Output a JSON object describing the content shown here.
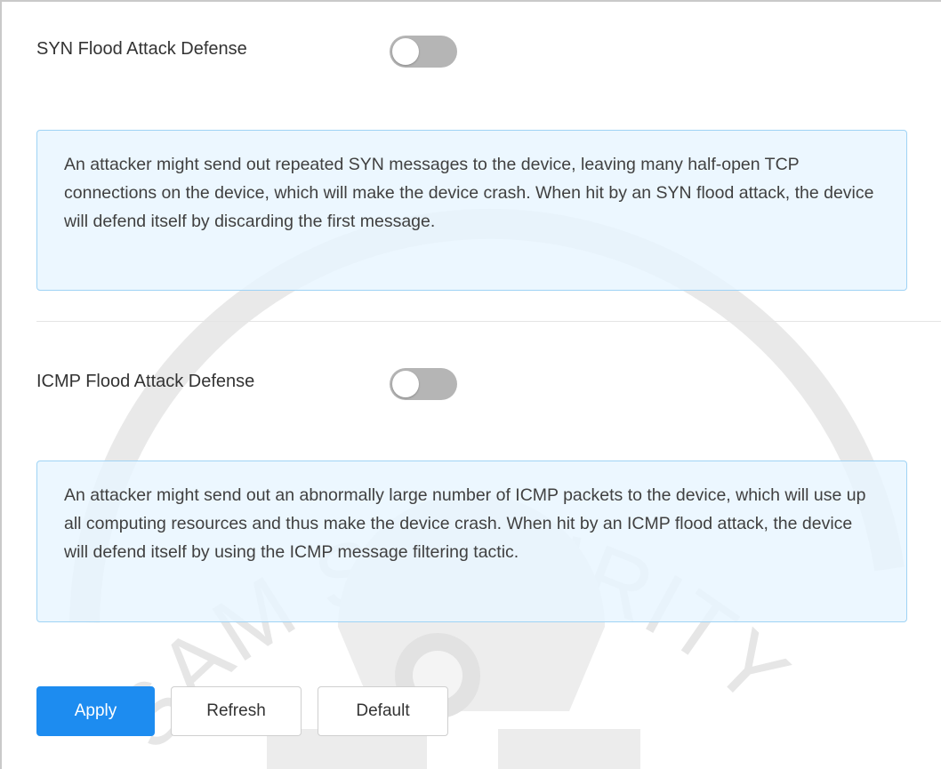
{
  "syn": {
    "label": "SYN Flood Attack Defense",
    "enabled": false,
    "description": "An attacker might send out repeated SYN messages to the device, leaving many half-open TCP connections on the device, which will make the device crash. When hit by an SYN flood attack, the device will defend itself by discarding the first message."
  },
  "icmp": {
    "label": "ICMP Flood Attack Defense",
    "enabled": false,
    "description": "An attacker might send out an abnormally large number of ICMP packets to the device, which will use up all computing resources and thus make the device crash. When hit by an ICMP flood attack, the device will defend itself by using the ICMP message filtering tactic."
  },
  "buttons": {
    "apply": "Apply",
    "refresh": "Refresh",
    "default": "Default"
  },
  "watermark": {
    "text": "SAM SECURITY"
  },
  "colors": {
    "primary": "#1d8cf0",
    "toggle_off": "#b5b5b5",
    "info_bg": "#e8f5ff",
    "info_border": "#9fd3f5"
  }
}
